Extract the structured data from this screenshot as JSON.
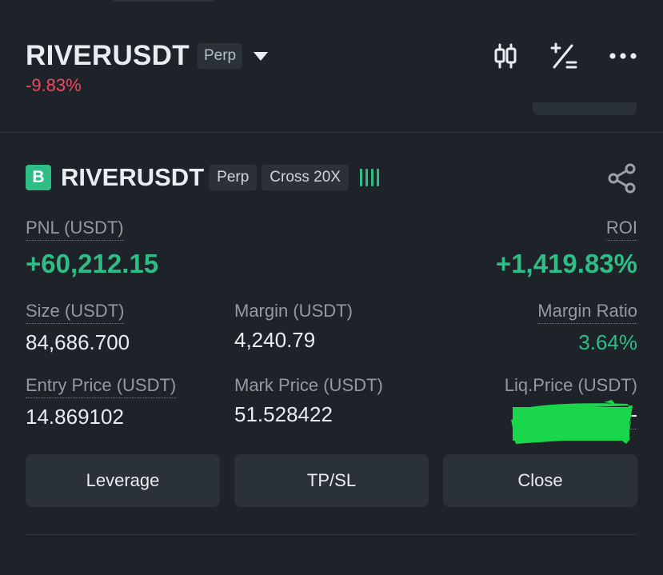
{
  "header": {
    "symbol": "RIVERUSDT",
    "type_tag": "Perp",
    "change": "-9.83%"
  },
  "icons": {
    "chart": "candlestick-chart-icon",
    "calculator": "calculator-icon",
    "more": "more-icon",
    "share": "share-icon"
  },
  "position": {
    "side_badge": "B",
    "symbol": "RIVERUSDT",
    "type_tag": "Perp",
    "margin_tag": "Cross 20X",
    "pnl_label": "PNL (USDT)",
    "pnl_value": "+60,212.15",
    "roi_label": "ROI",
    "roi_value": "+1,419.83%",
    "size_label": "Size (USDT)",
    "size_value": "84,686.700",
    "margin_label": "Margin (USDT)",
    "margin_value": "4,240.79",
    "margin_ratio_label": "Margin Ratio",
    "margin_ratio_value": "3.64%",
    "entry_label": "Entry Price (USDT)",
    "entry_value": "14.869102",
    "mark_label": "Mark Price (USDT)",
    "mark_value": "51.528422",
    "liq_label": "Liq.Price (USDT)",
    "liq_value": "-"
  },
  "buttons": {
    "leverage": "Leverage",
    "tpsl": "TP/SL",
    "close": "Close"
  },
  "colors": {
    "background": "#1e2229",
    "positive": "#2ebd85",
    "negative": "#f6465d",
    "surface": "#2b3139"
  }
}
